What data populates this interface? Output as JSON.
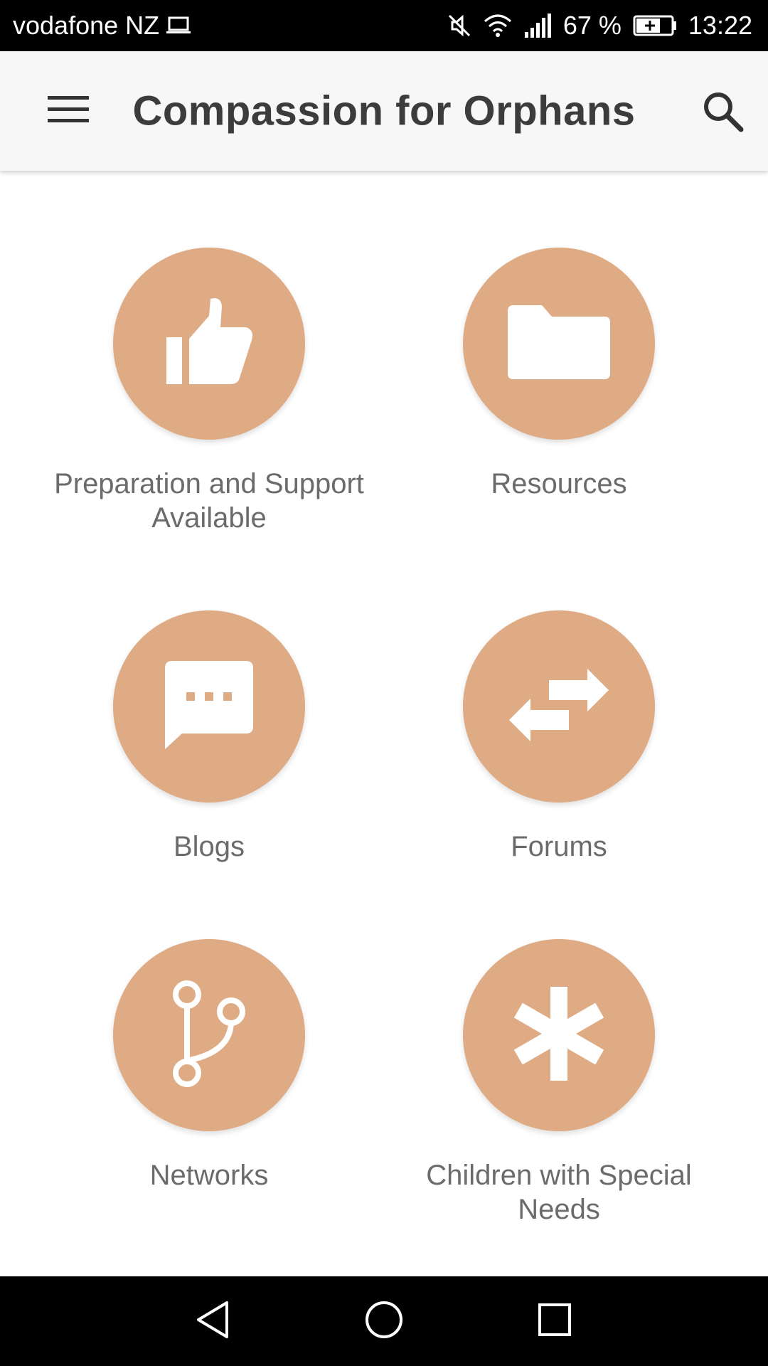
{
  "status_bar": {
    "carrier": "vodafone NZ",
    "signal_text": "67 %",
    "time": "13:22"
  },
  "app_bar": {
    "title": "Compassion for Orphans"
  },
  "tiles": [
    {
      "label": "Preparation and Support Available",
      "icon": "thumbs-up-icon"
    },
    {
      "label": "Resources",
      "icon": "folder-icon"
    },
    {
      "label": "Blogs",
      "icon": "chat-bubble-icon"
    },
    {
      "label": "Forums",
      "icon": "swap-arrows-icon"
    },
    {
      "label": "Networks",
      "icon": "branch-icon"
    },
    {
      "label": "Children with Special Needs",
      "icon": "asterisk-icon"
    }
  ],
  "colors": {
    "accent": "#dfab85",
    "app_bar_bg": "#f7f7f7",
    "title_text": "#3c3c3c",
    "label_text": "#6b6b6b"
  }
}
